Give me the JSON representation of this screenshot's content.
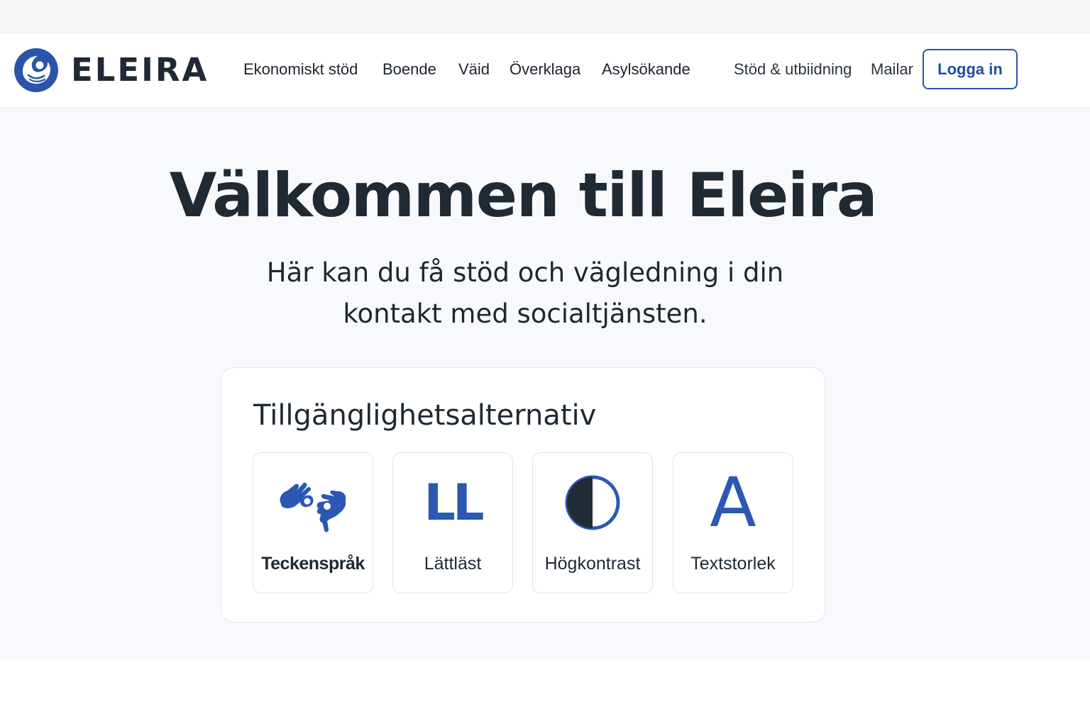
{
  "brand": {
    "name": "ELEIRA",
    "accent": "#2a55aa",
    "logo_icon": "mother-child-icon"
  },
  "nav": {
    "items": [
      {
        "label": "Ekonomiskt stöd"
      },
      {
        "label": "Boende"
      },
      {
        "label": "Väid"
      },
      {
        "label": "Överklaga"
      },
      {
        "label": "Asylsökande"
      },
      {
        "label": "Stöd & utbiidning"
      },
      {
        "label": "Mailar"
      }
    ],
    "login_label": "Logga in"
  },
  "hero": {
    "title": "Välkommen till Eleira",
    "subtitle": "Här kan du få stöd och vägledning i din kontakt med socialtjänsten."
  },
  "accessibility": {
    "title": "Tillgänglighetsalternativ",
    "options": [
      {
        "label": "Teckenspråk",
        "icon": "sign-language-icon"
      },
      {
        "label": "Lättläst",
        "icon": "easy-read-icon",
        "glyph": "LL"
      },
      {
        "label": "Högkontrast",
        "icon": "contrast-icon"
      },
      {
        "label": "Textstorlek",
        "icon": "text-size-icon",
        "glyph": "A"
      }
    ]
  }
}
